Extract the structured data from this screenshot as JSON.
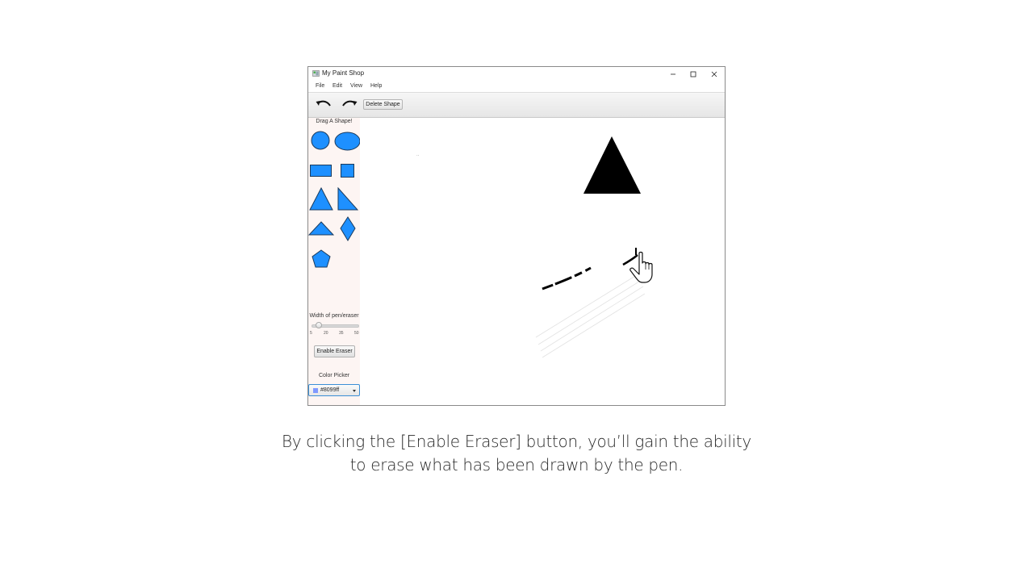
{
  "window": {
    "title": "My Paint Shop"
  },
  "menu": [
    "File",
    "Edit",
    "View",
    "Help"
  ],
  "toolbar": {
    "undo_icon": "undo-icon",
    "redo_icon": "redo-icon",
    "delete_label": "Delete Shape"
  },
  "sidebar": {
    "title": "Drag A Shape!",
    "shapes": [
      "circle",
      "ellipse",
      "rectangle",
      "square",
      "triangle",
      "right-triangle",
      "wide-triangle",
      "diamond",
      "pentagon"
    ],
    "shape_fill": "#1e90ff",
    "width_label": "Width of pen/eraser",
    "slider": {
      "min": 5,
      "max": 50,
      "value": 10,
      "ticks": [
        "5",
        "20",
        "35",
        "50"
      ]
    },
    "eraser_label": "Enable Eraser",
    "picker_label": "Color Picker",
    "picker_value": "#8099ff",
    "picker_color": "#8099ff"
  },
  "canvas": {
    "dot_text": ".."
  },
  "caption": {
    "line1": "By clicking the [Enable Eraser] button, you’ll gain the ability",
    "line2": "to erase what has been drawn by the pen."
  }
}
